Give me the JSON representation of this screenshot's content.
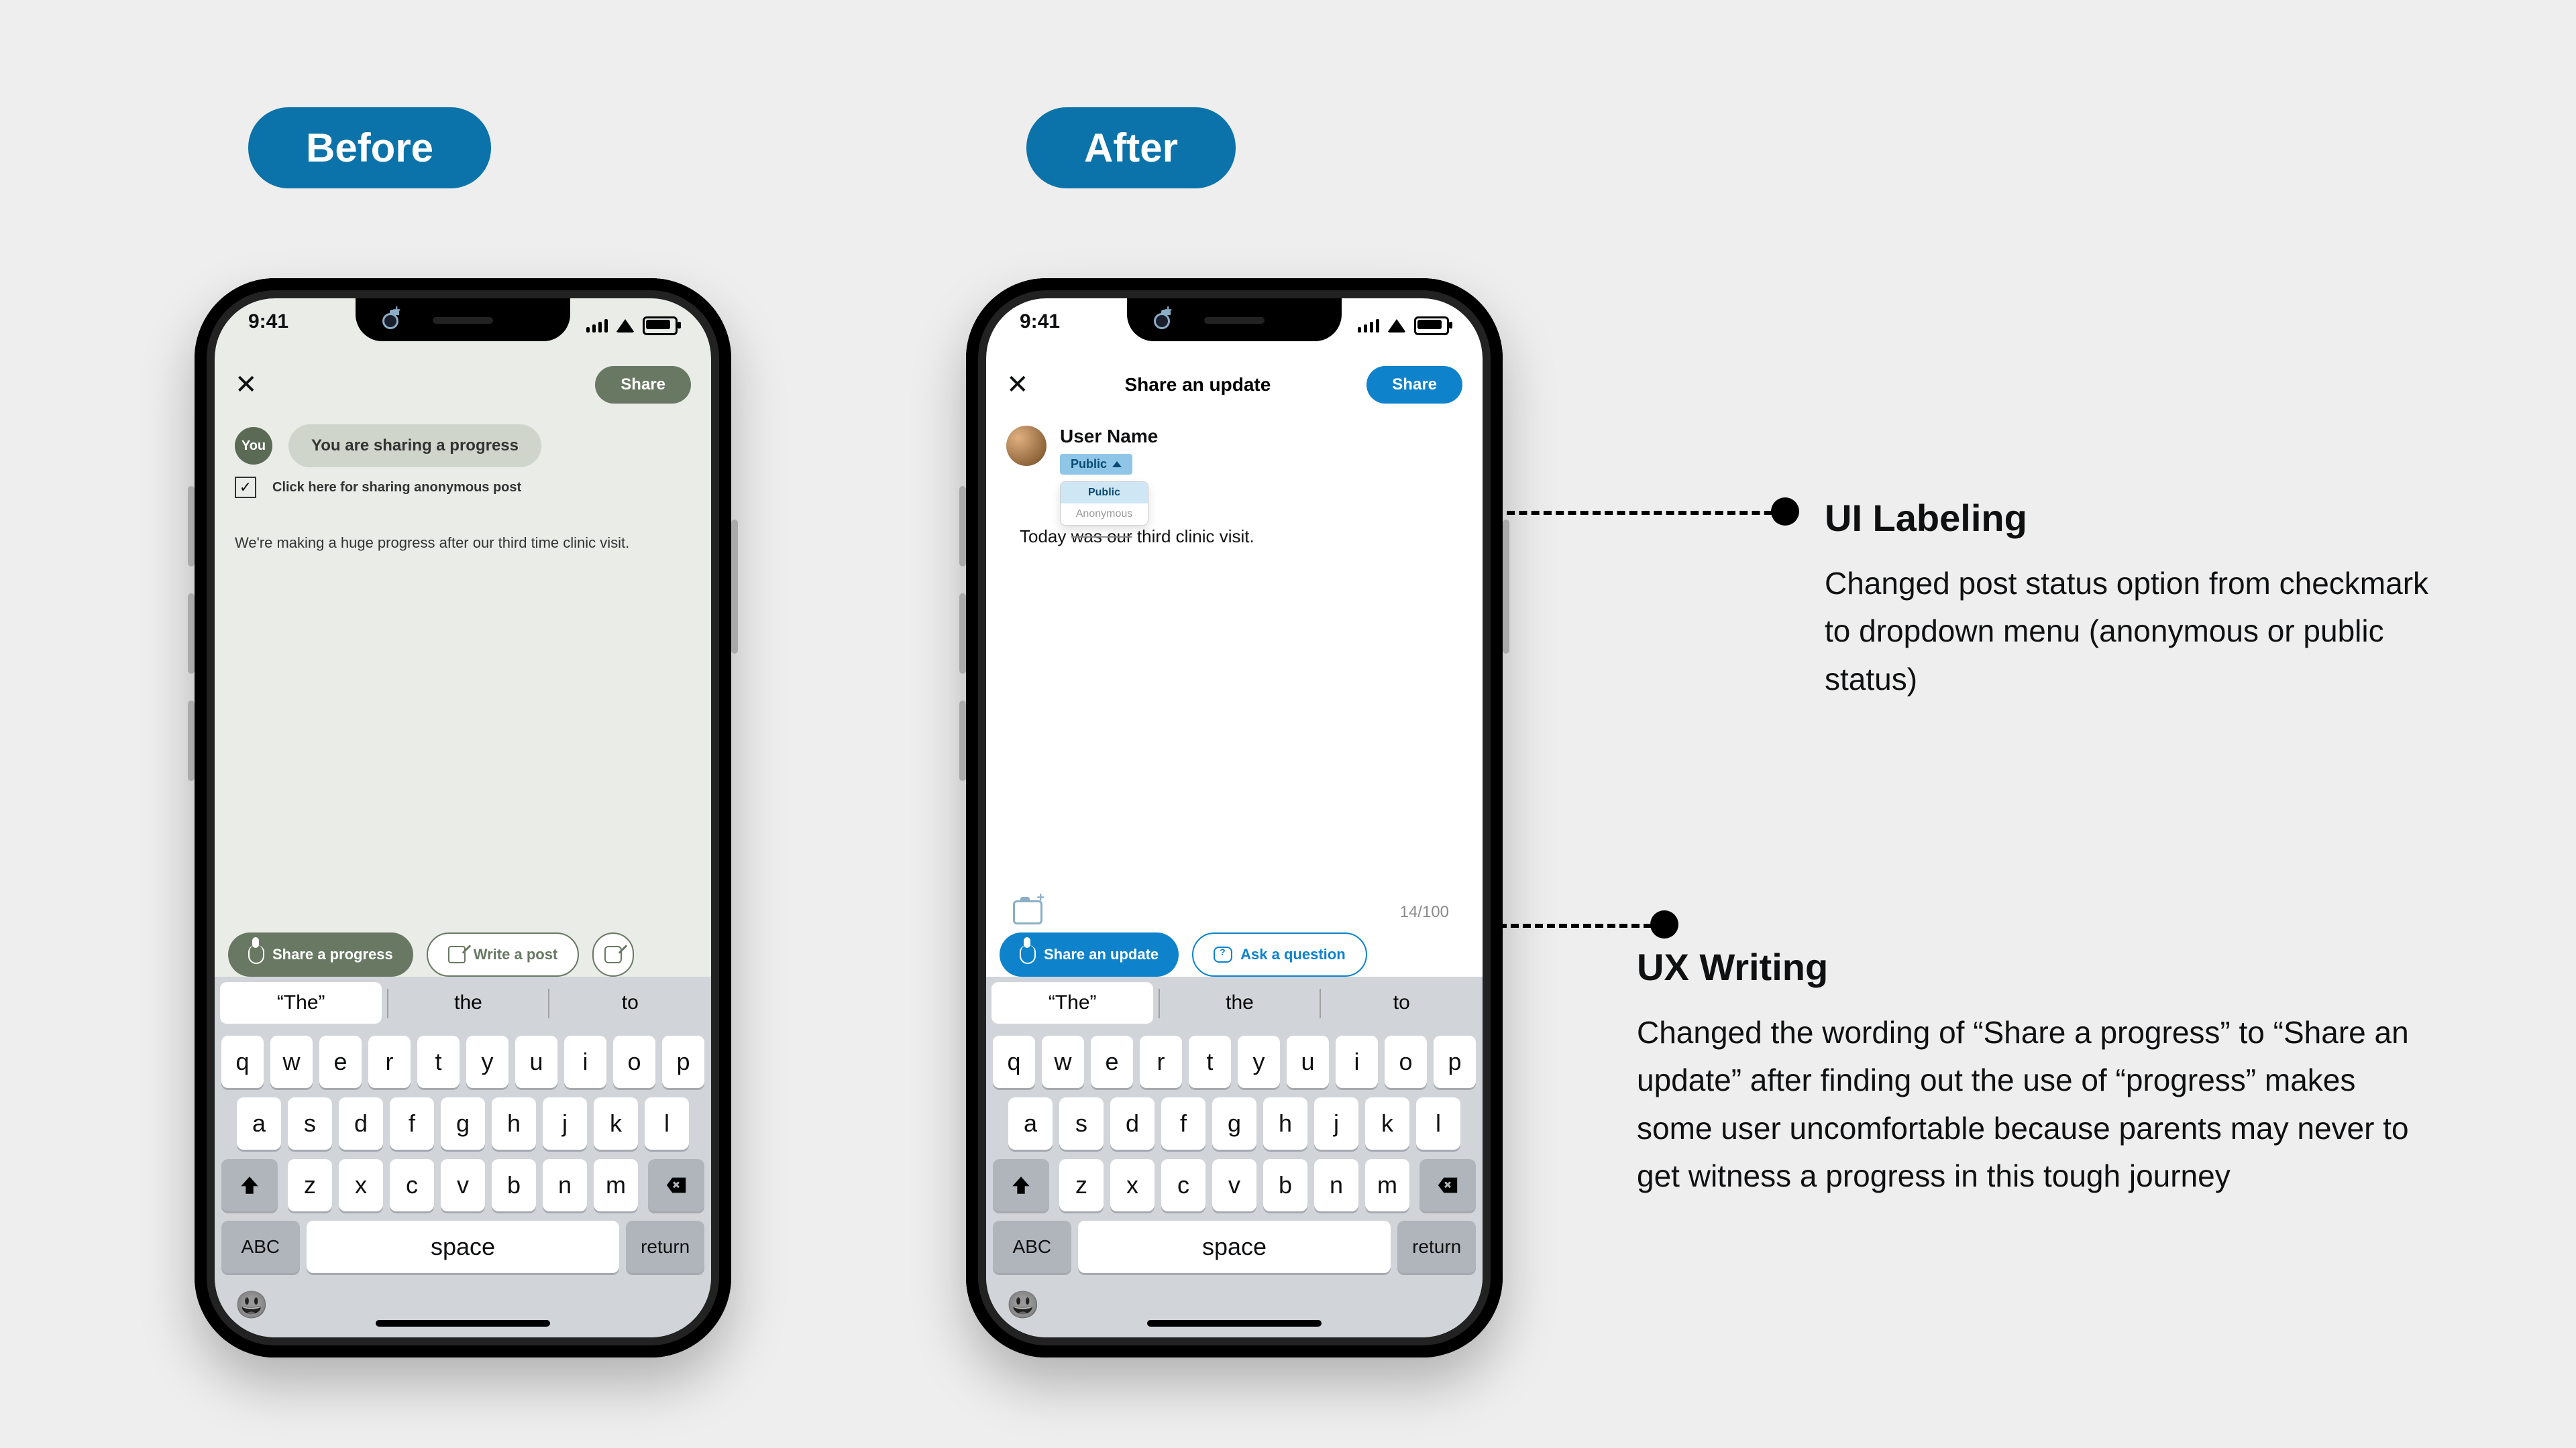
{
  "badges": {
    "before": "Before",
    "after": "After"
  },
  "status": {
    "time": "9:41"
  },
  "before": {
    "share_btn": "Share",
    "avatar_label": "You",
    "bubble": "You are sharing a progress",
    "checkbox_label": "Click here for sharing anonymous post",
    "textarea": "We're making a huge progress after our third time clinic visit.",
    "actions": {
      "primary": "Share a progress",
      "secondary": "Write a post"
    }
  },
  "after": {
    "header_title": "Share an update",
    "share_btn": "Share",
    "user_name": "User Name",
    "visibility_selected": "Public",
    "visibility_options": {
      "public": "Public",
      "anonymous": "Anonymous"
    },
    "text_before_strike": "Today ",
    "text_strike": "was our",
    "text_after_strike": " third clinic visit.",
    "counter": "14/100",
    "actions": {
      "primary": "Share an update",
      "secondary": "Ask a question"
    }
  },
  "keyboard": {
    "sug1": "“The”",
    "sug2": "the",
    "sug3": "to",
    "row1": [
      "q",
      "w",
      "e",
      "r",
      "t",
      "y",
      "u",
      "i",
      "o",
      "p"
    ],
    "row2": [
      "a",
      "s",
      "d",
      "f",
      "g",
      "h",
      "j",
      "k",
      "l"
    ],
    "row3": [
      "z",
      "x",
      "c",
      "v",
      "b",
      "n",
      "m"
    ],
    "abc": "ABC",
    "space": "space",
    "return": "return"
  },
  "callouts": {
    "c1_title": "UI Labeling",
    "c1_body": "Changed post status option from checkmark to dropdown menu (anonymous or public status)",
    "c2_title": "UX Writing",
    "c2_body": "Changed the wording of “Share a progress” to “Share an update” after finding out the use of  “progress” makes some user uncomfortable because parents may never to get witness a progress in this tough journey"
  }
}
